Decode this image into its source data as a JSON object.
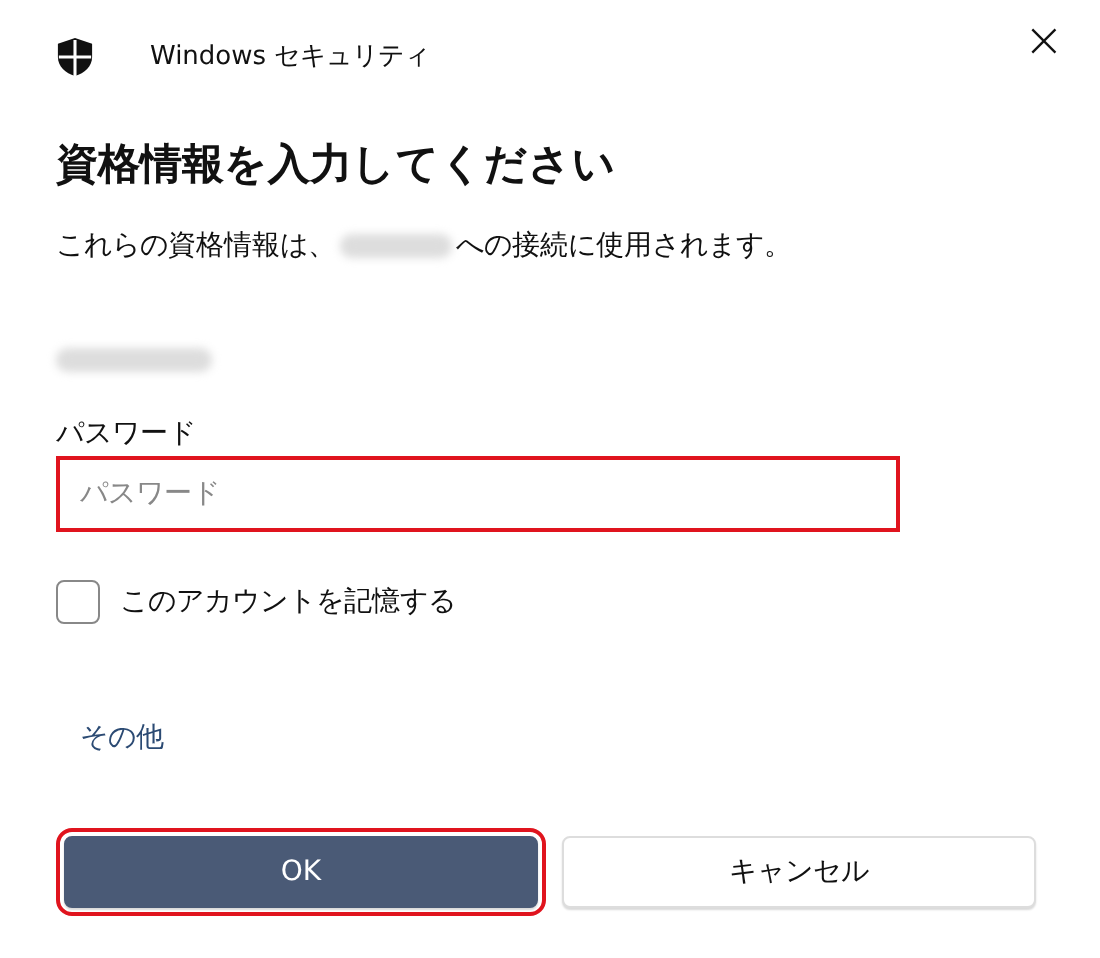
{
  "window": {
    "title": "Windows セキュリティ",
    "close": "×"
  },
  "heading": "資格情報を入力してください",
  "message": {
    "before": "これらの資格情報は、",
    "after": "への接続に使用されます。"
  },
  "password": {
    "label": "パスワード",
    "placeholder": "パスワード",
    "highlighted": true
  },
  "remember": {
    "label": "このアカウントを記憶する",
    "checked": false
  },
  "more_link": "その他",
  "buttons": [
    {
      "label": "OK",
      "kind": "primary",
      "highlighted": true
    },
    {
      "label": "キャンセル",
      "kind": "secondary",
      "highlighted": false
    }
  ]
}
